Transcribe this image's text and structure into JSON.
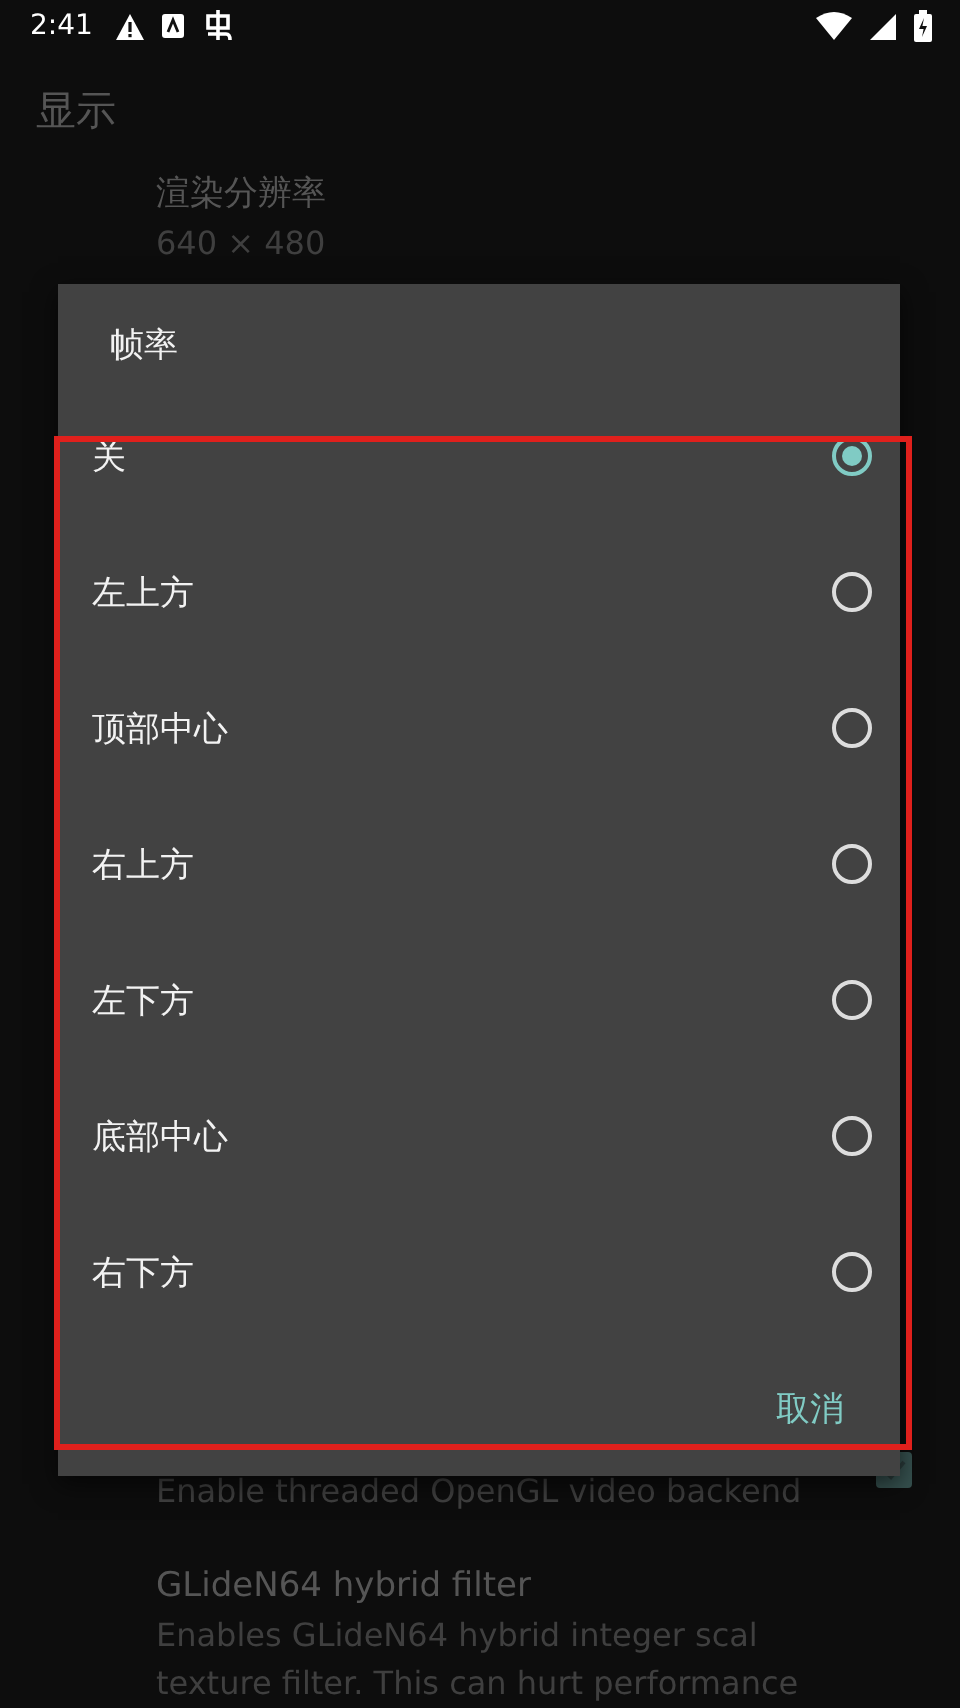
{
  "status_bar": {
    "time": "2:41"
  },
  "header": {
    "title": "显示"
  },
  "settings_top": [
    {
      "title": "渲染分辨率",
      "summary": "640 × 480"
    }
  ],
  "settings_bottom": [
    {
      "kind": "checkbox",
      "summary_lines": [
        "Enable threaded OpenGL video backend"
      ],
      "checked": true
    },
    {
      "kind": "text",
      "title": "GLideN64 hybrid filter",
      "summary_lines": [
        "Enables GLideN64 hybrid integer scal",
        "texture filter. This can hurt performance"
      ]
    }
  ],
  "dialog": {
    "title": "帧率",
    "options": [
      {
        "label": "关",
        "selected": true
      },
      {
        "label": "左上方",
        "selected": false
      },
      {
        "label": "顶部中心",
        "selected": false
      },
      {
        "label": "右上方",
        "selected": false
      },
      {
        "label": "左下方",
        "selected": false
      },
      {
        "label": "底部中心",
        "selected": false
      },
      {
        "label": "右下方",
        "selected": false
      }
    ],
    "cancel": "取消"
  }
}
